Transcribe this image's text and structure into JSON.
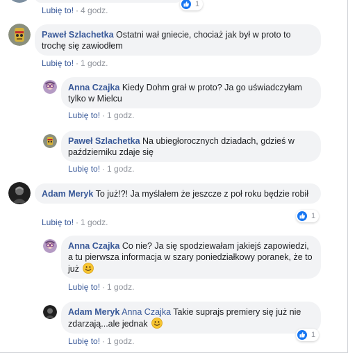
{
  "top_comment": {
    "like_label": "Lubię to!",
    "separator": "·",
    "time": "4 godz.",
    "reaction_count": "1"
  },
  "comments": [
    {
      "author": "Paweł Szlachetka",
      "text": "Ostatni wał gniecie, chociaż jak był w proto to trochę się zawiodłem",
      "like_label": "Lubię to!",
      "separator": "·",
      "time": "1 godz."
    },
    {
      "author": "Anna Czajka",
      "text": "Kiedy Dohm grał w proto? Ja go uświadczyłam tylko w Mielcu",
      "like_label": "Lubię to!",
      "separator": "·",
      "time": "1 godz."
    },
    {
      "author": "Paweł Szlachetka",
      "text": "Na ubiegłorocznych dziadach, gdzieś w październiku zdaje się",
      "like_label": "Lubię to!",
      "separator": "·",
      "time": "1 godz."
    },
    {
      "author": "Adam Meryk",
      "text": "To już!?! Ja myślałem że jeszcze z poł roku będzie robił",
      "like_label": "Lubię to!",
      "separator": "·",
      "time": "1 godz.",
      "reaction_count": "1"
    },
    {
      "author": "Anna Czajka",
      "text": "Co nie? Ja się spodziewałam jakiejś zapowiedzi, a tu pierwsza informacja w szary poniedziałkowy poranek, że to już",
      "emoji": "smiling-face",
      "like_label": "Lubię to!",
      "separator": "·",
      "time": "1 godz."
    },
    {
      "author": "Adam Meryk",
      "mention": "Anna Czajka",
      "text": "Takie suprajs premiery się już nie zdarzają...ale jednak",
      "emoji": "smiling-face",
      "like_label": "Lubię to!",
      "separator": "·",
      "time": "1 godz.",
      "reaction_count": "1"
    }
  ],
  "colors": {
    "link": "#385898",
    "bubble": "#f2f3f5",
    "meta": "#90949c",
    "like_reaction": "#1877f2"
  }
}
